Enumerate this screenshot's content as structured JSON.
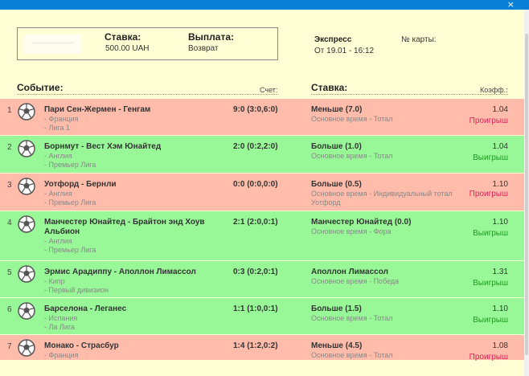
{
  "header": {
    "close_glyph": "×"
  },
  "bet": {
    "stake_label": "Ставка:",
    "stake_value": "500.00 UAH",
    "payout_label": "Выплата:",
    "payout_value": "Возврат",
    "type": "Экспресс",
    "date": "От 19.01 - 16:12",
    "card_label": "№ карты:"
  },
  "columns": {
    "event": "Событие:",
    "score": "Счет:",
    "stake": "Ставка:",
    "coef": "Коэфф.:"
  },
  "colors": {
    "lose_bg": "#ffbcaa",
    "win_bg": "#98f898",
    "lose_text": "#e0205a",
    "win_text": "#1c9a1c",
    "accent": "#0a7fd8"
  },
  "events": [
    {
      "n": "1",
      "status": "lose",
      "teams": "Пари Сен-Жермен - Генгам",
      "country": "- Франция",
      "league": "- Лига 1",
      "score": "9:0 (3:0,6:0)",
      "bet": "Меньше (7.0)",
      "market": "Основное время - Тотал",
      "coef": "1.04",
      "result": "Проигрыш",
      "icon": "soccer-ball-icon"
    },
    {
      "n": "2",
      "status": "win",
      "teams": "Борнмут - Вест Хэм Юнайтед",
      "country": "- Англия",
      "league": "- Премьер Лига",
      "score": "2:0 (0:2,2:0)",
      "bet": "Больше (1.0)",
      "market": "Основное время - Тотал",
      "coef": "1.04",
      "result": "Выигрыш",
      "icon": "soccer-ball-icon"
    },
    {
      "n": "3",
      "status": "lose",
      "teams": "Уотфорд - Бернли",
      "country": "- Англия",
      "league": "- Премьер Лига",
      "score": "0:0 (0:0,0:0)",
      "bet": "Больше (0.5)",
      "market": "Основное время - Индивидуальный тотал Уотфорд",
      "coef": "1.10",
      "result": "Проигрыш",
      "icon": "soccer-ball-icon"
    },
    {
      "n": "4",
      "status": "win",
      "teams": "Манчестер Юнайтед - Брайтон энд Хоув Альбион",
      "country": "- Англия",
      "league": "- Премьер Лига",
      "score": "2:1 (2:0,0:1)",
      "bet": "Манчестер Юнайтед (0.0)",
      "market": "Основное время - Фора",
      "coef": "1.10",
      "result": "Выигрыш",
      "icon": "soccer-ball-icon"
    },
    {
      "n": "5",
      "status": "win",
      "teams": "Эрмис Арадиппу - Аполлон Лимассол",
      "country": "- Кипр",
      "league": "- Первый дивизион",
      "score": "0:3 (0:2,0:1)",
      "bet": "Аполлон Лимассол",
      "market": "Основное время - Победа",
      "coef": "1.31",
      "result": "Выигрыш",
      "icon": "soccer-ball-icon"
    },
    {
      "n": "6",
      "status": "win",
      "teams": "Барселона - Леганес",
      "country": "- Испания",
      "league": "- Ла Лига",
      "score": "1:1 (1:0,0:1)",
      "bet": "Больше (1.5)",
      "market": "Основное время - Тотал",
      "coef": "1.10",
      "result": "Выигрыш",
      "icon": "soccer-ball-icon"
    },
    {
      "n": "7",
      "status": "lose",
      "teams": "Монако - Страсбур",
      "country": "- Франция",
      "league": "",
      "score": "1:4 (1:2,0:2)",
      "bet": "Меньше (4.5)",
      "market": "Основное время - Тотал",
      "coef": "1.08",
      "result": "Проигрыш",
      "icon": "soccer-ball-icon"
    }
  ]
}
